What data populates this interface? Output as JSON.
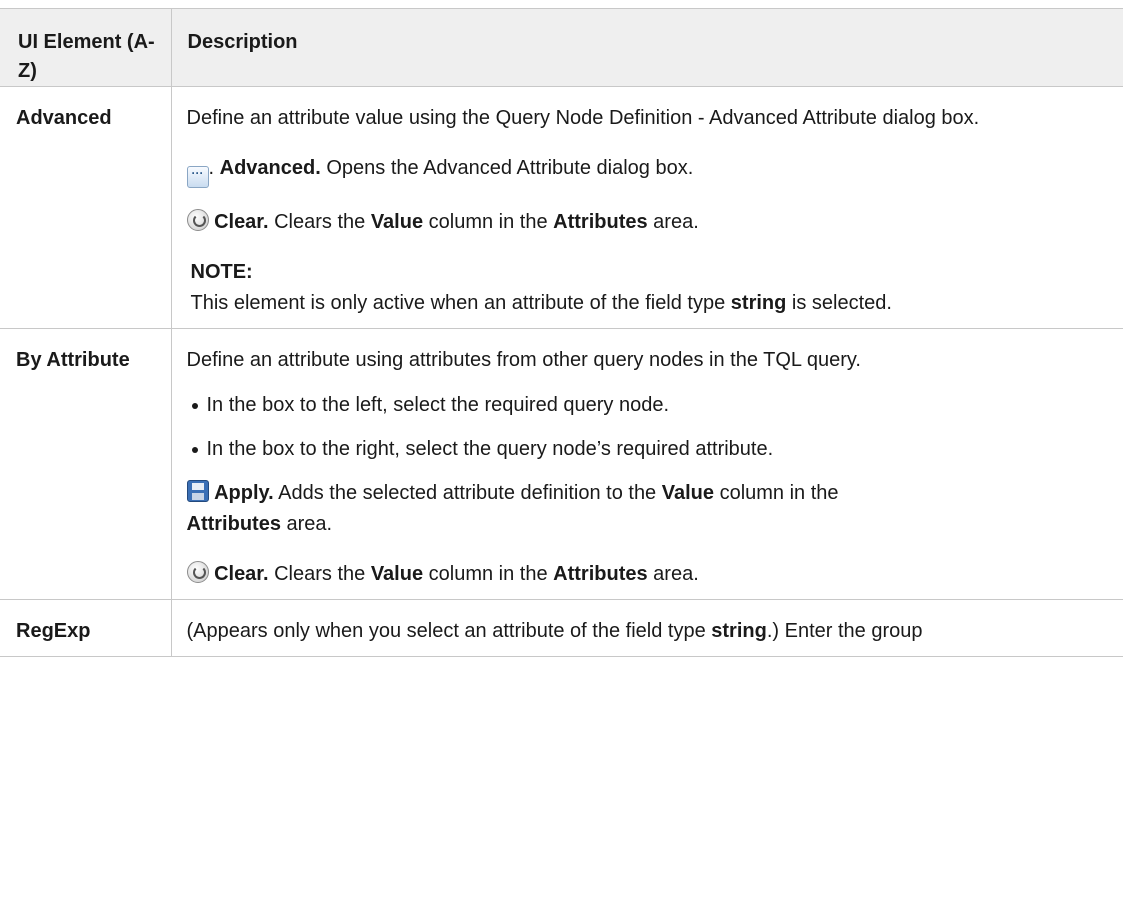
{
  "header": {
    "col1": "UI Element (A-Z)",
    "col2": "Description"
  },
  "rows": [
    {
      "name": "Advanced",
      "intro": "Define an attribute value using the Query Node Definition - Advanced Attribute dialog box.",
      "advanced_btn": {
        "title": "Advanced.",
        "text": " Opens the Advanced Attribute dialog box."
      },
      "clear_btn": {
        "title": "Clear.",
        "t1": " Clears the ",
        "b1": "Value",
        "t2": " column in the ",
        "b2": "Attributes",
        "t3": " area."
      },
      "note": {
        "title": "NOTE:",
        "t1": "This element is only active when an attribute of the field type ",
        "b1": "string",
        "t2": " is selected."
      }
    },
    {
      "name": "By Attribute",
      "intro": "Define an attribute using attributes from other query nodes in the TQL query.",
      "bullets": [
        "In the box to the left, select the required query node.",
        "In the box to the right, select the query node’s required attribute."
      ],
      "apply_btn": {
        "title": "Apply.",
        "t1": " Adds the selected attribute definition to the ",
        "b1": "Value",
        "t2": " column in the ",
        "b2": "Attributes",
        "t3": " area."
      },
      "clear_btn": {
        "title": "Clear.",
        "t1": " Clears the ",
        "b1": "Value",
        "t2": " column in the ",
        "b2": "Attributes",
        "t3": " area."
      }
    },
    {
      "name": "RegExp",
      "t1": "(Appears only when you select an attribute of the field type ",
      "b1": "string",
      "t2": ".) Enter the group"
    }
  ]
}
